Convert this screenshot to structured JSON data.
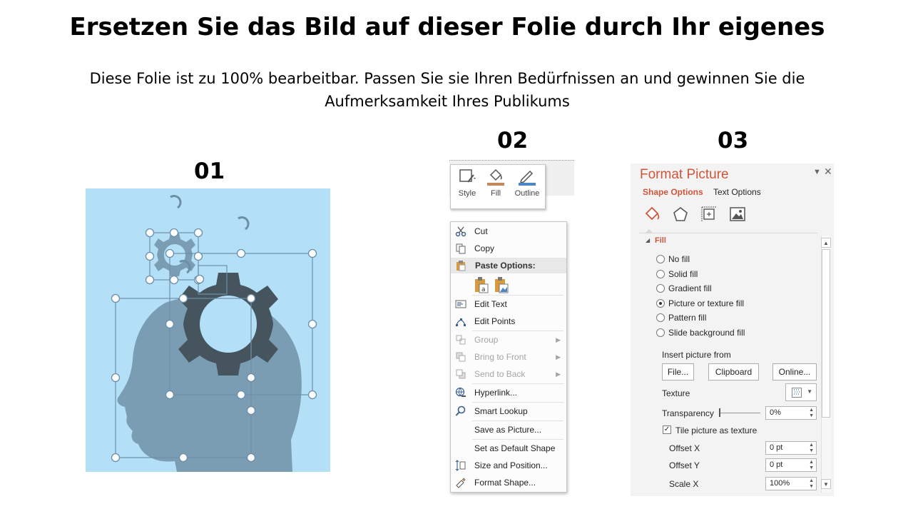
{
  "slide": {
    "title": "Ersetzen Sie das Bild auf dieser Folie durch Ihr eigenes",
    "subtitle_line1": "Diese Folie ist zu 100% bearbeitbar. Passen Sie sie Ihren Bedürfnissen an und gewinnen Sie die",
    "subtitle_line2": "Aufmerksamkeit Ihres Publikums",
    "num1": "01",
    "num2": "02",
    "num3": "03"
  },
  "colors": {
    "panel_bg": "#b3e0f7",
    "head": "#7b9db3",
    "gear_dark": "#46545e",
    "gear_light": "#7b9db3",
    "selection": "#6c8fa8",
    "accent": "#d0563b"
  },
  "mini_toolbar": {
    "style": "Style",
    "fill": "Fill",
    "outline": "Outline"
  },
  "context_menu": {
    "cut": "Cut",
    "copy": "Copy",
    "paste_options": "Paste Options:",
    "edit_text": "Edit Text",
    "edit_points": "Edit Points",
    "group": "Group",
    "bring_to_front": "Bring to Front",
    "send_to_back": "Send to Back",
    "hyperlink": "Hyperlink...",
    "smart_lookup": "Smart Lookup",
    "save_as_picture": "Save as Picture...",
    "set_default_shape": "Set as Default Shape",
    "size_position": "Size and Position...",
    "format_shape": "Format Shape..."
  },
  "format_picture": {
    "title": "Format Picture",
    "tab_shape": "Shape Options",
    "tab_text": "Text Options",
    "section_fill": "Fill",
    "options": [
      "No fill",
      "Solid fill",
      "Gradient fill",
      "Picture or texture fill",
      "Pattern fill",
      "Slide background fill"
    ],
    "selected_index": 3,
    "insert_from": "Insert picture from",
    "btn_file": "File...",
    "btn_clipboard": "Clipboard",
    "btn_online": "Online...",
    "texture": "Texture",
    "transparency": "Transparency",
    "transparency_value": "0%",
    "tile_label": "Tile picture as texture",
    "tile_checked": true,
    "offset_x": "Offset X",
    "offset_x_value": "0 pt",
    "offset_y": "Offset Y",
    "offset_y_value": "0 pt",
    "scale_x": "Scale X",
    "scale_x_value": "100%"
  }
}
